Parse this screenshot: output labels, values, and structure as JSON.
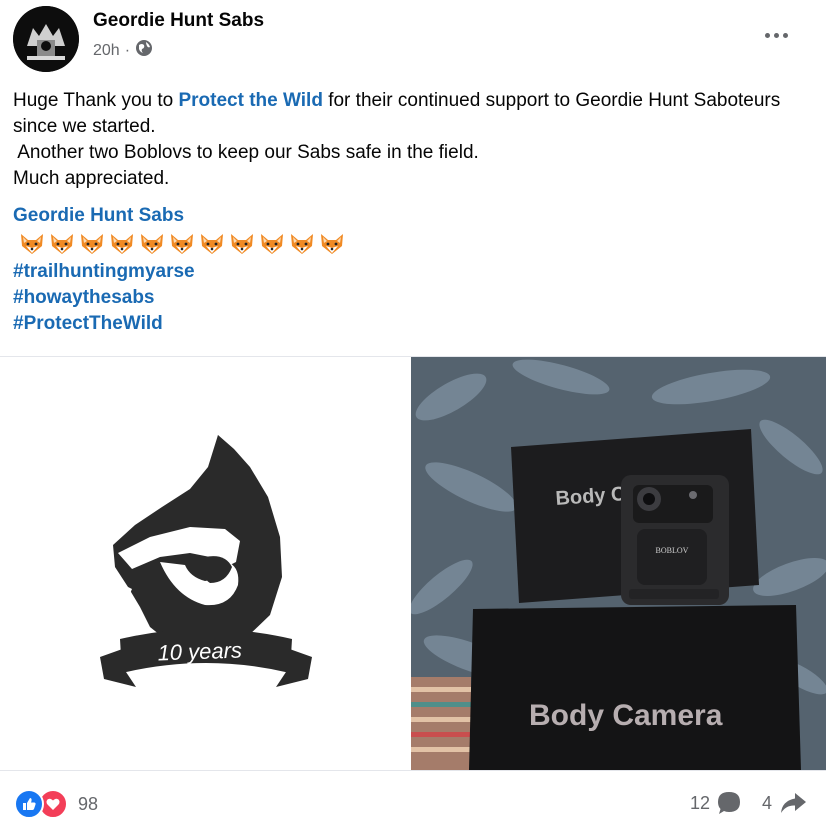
{
  "post": {
    "page_name": "Geordie Hunt Sabs",
    "time": "20h",
    "separator": "·",
    "globe_icon": "globe-icon",
    "more_icon": "more-horizontal-icon"
  },
  "text": {
    "line1_before": "Huge Thank you to ",
    "line1_link": "Protect the Wild",
    "line1_after": " for their continued support to Geordie Hunt Saboteurs since we started.",
    "line2": " Another two Boblovs to keep our Sabs safe in the field.",
    "line3": "Much appreciated.",
    "mention": "Geordie Hunt Sabs",
    "fox_emoji": "fox-face-emoji",
    "fox_count": 11,
    "hashtags": [
      "#trailhuntingmyarse",
      "#howaythesabs",
      "#ProtectTheWild"
    ]
  },
  "photos": {
    "left_banner": "10 years",
    "right_box_top": "Body C",
    "right_camera_brand": "BOBLOV",
    "right_box_bottom": "Body Camera"
  },
  "footer": {
    "reactions_count": "98",
    "reaction_icons": [
      "like-icon",
      "love-icon"
    ],
    "comments_count": "12",
    "comment_icon": "comment-icon",
    "shares_count": "4",
    "share_icon": "share-icon"
  },
  "colors": {
    "link": "#1a6ab3",
    "muted": "#65676b",
    "like": "#1877f2",
    "love": "#f33e58"
  }
}
